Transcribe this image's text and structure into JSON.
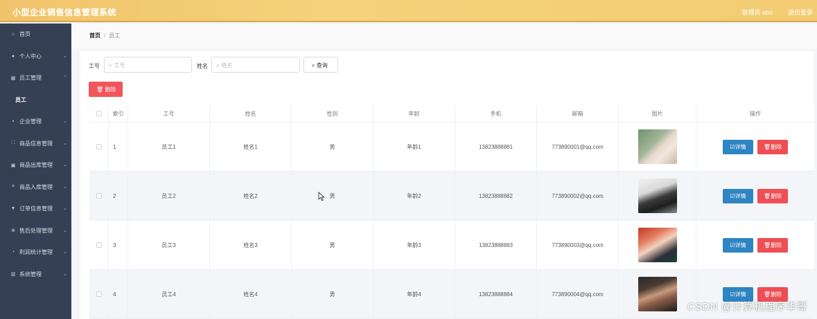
{
  "app": {
    "title": "小型企业销售信息管理系统",
    "admin_label": "管理员 abo",
    "logout_label": "退出登录"
  },
  "colors": {
    "topbar": "#f3cc73",
    "sidebar": "#354054",
    "danger": "#f0565c",
    "primary": "#2f84c2"
  },
  "sidebar": {
    "items": [
      {
        "label": "首页",
        "icon": "home-icon",
        "glyph": "⌂",
        "has_arrow": false
      },
      {
        "label": "个人中心",
        "icon": "user-icon",
        "glyph": "●",
        "has_arrow": true
      },
      {
        "label": "员工管理",
        "icon": "grid-icon",
        "glyph": "▦",
        "has_arrow": true,
        "expanded": true
      },
      {
        "label": "员工",
        "icon": "",
        "glyph": "",
        "has_arrow": false,
        "submenu": true
      },
      {
        "label": "企业管理",
        "icon": "apps-icon",
        "glyph": "▪",
        "has_arrow": true
      },
      {
        "label": "商品信息管理",
        "icon": "scan-icon",
        "glyph": "⛶",
        "has_arrow": true
      },
      {
        "label": "商品出库管理",
        "icon": "box-icon",
        "glyph": "▣",
        "has_arrow": true
      },
      {
        "label": "商品入库管理",
        "icon": "crop-icon",
        "glyph": "⌗",
        "has_arrow": true
      },
      {
        "label": "订单信息管理",
        "icon": "funnel-icon",
        "glyph": "▼",
        "has_arrow": true
      },
      {
        "label": "售后处理管理",
        "icon": "settings-circle-icon",
        "glyph": "⊗",
        "has_arrow": true
      },
      {
        "label": "利润统计管理",
        "icon": "chart-circle-icon",
        "glyph": "◔",
        "has_arrow": true
      },
      {
        "label": "系统管理",
        "icon": "building-icon",
        "glyph": "▥",
        "has_arrow": true
      }
    ]
  },
  "breadcrumb": {
    "home": "首页",
    "separator": "/",
    "current": "员工"
  },
  "search": {
    "id_label": "工号",
    "id_placeholder": "工号",
    "name_label": "姓名",
    "name_placeholder": "姓名",
    "query_label": "查询"
  },
  "toolbar": {
    "delete_label": "删除"
  },
  "table": {
    "headers": [
      "索引",
      "工号",
      "姓名",
      "性别",
      "年龄",
      "手机",
      "邮箱",
      "图片",
      "操作"
    ],
    "rows": [
      {
        "index": "1",
        "emp_id": "员工1",
        "name": "姓名1",
        "gender": "男",
        "age": "年龄1",
        "phone": "13823888881",
        "email": "773890001@qq.com"
      },
      {
        "index": "2",
        "emp_id": "员工2",
        "name": "姓名2",
        "gender": "男",
        "age": "年龄2",
        "phone": "13823888882",
        "email": "773890002@qq.com"
      },
      {
        "index": "3",
        "emp_id": "员工3",
        "name": "姓名3",
        "gender": "男",
        "age": "年龄3",
        "phone": "13823888883",
        "email": "773890003@qq.com"
      },
      {
        "index": "4",
        "emp_id": "员工4",
        "name": "姓名4",
        "gender": "男",
        "age": "年龄4",
        "phone": "13823888884",
        "email": "773890004@qq.com"
      }
    ],
    "detail_label": "详情",
    "delete_label": "删除"
  },
  "watermark": "CSDN @计算机程序华哥"
}
